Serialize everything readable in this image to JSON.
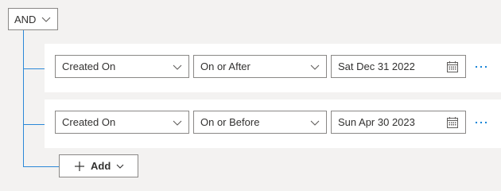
{
  "group": {
    "operator": "AND",
    "operator_icon": "chevron-down-icon"
  },
  "conditions": [
    {
      "field": "Created On",
      "operator": "On or After",
      "value": "Sat Dec 31 2022",
      "more_icon": "ellipsis-icon"
    },
    {
      "field": "Created On",
      "operator": "On or Before",
      "value": "Sun Apr 30 2023",
      "more_icon": "ellipsis-icon"
    }
  ],
  "add_button": {
    "label": "Add",
    "icon": "plus-icon"
  },
  "colors": {
    "tree_line": "#2b88d8",
    "border": "#8a8886",
    "background": "#f3f2f1",
    "accent": "#0078d4"
  }
}
